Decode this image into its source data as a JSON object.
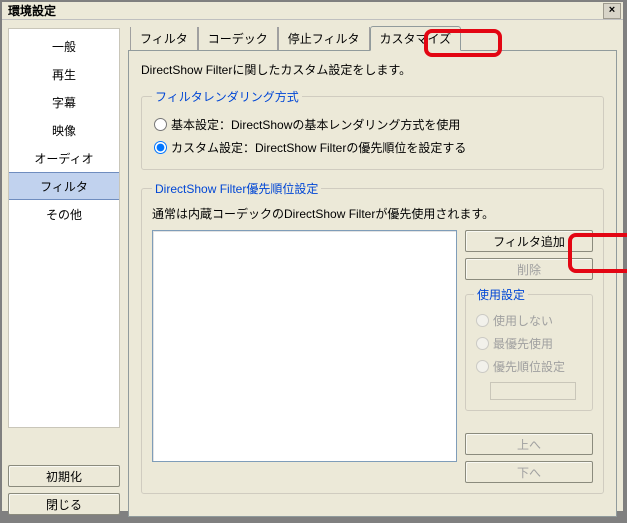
{
  "window": {
    "title": "環境設定",
    "close": "×"
  },
  "sidebar": {
    "items": [
      {
        "label": "一般"
      },
      {
        "label": "再生"
      },
      {
        "label": "字幕"
      },
      {
        "label": "映像"
      },
      {
        "label": "オーディオ"
      },
      {
        "label": "フィルタ"
      },
      {
        "label": "その他"
      }
    ],
    "selected_index": 5,
    "init_label": "初期化",
    "close_label": "閉じる"
  },
  "tabs": {
    "items": [
      {
        "label": "フィルタ"
      },
      {
        "label": "コーデック"
      },
      {
        "label": "停止フィルタ"
      },
      {
        "label": "カスタマイズ"
      }
    ],
    "active_index": 3
  },
  "page": {
    "description": "DirectShow Filterに関したカスタム設定をします。",
    "render_group": "フィルタレンダリング方式",
    "render_basic": "基本設定：DirectShowの基本レンダリング方式を使用",
    "render_custom": "カスタム設定：DirectShow Filterの優先順位を設定する",
    "priority_group": "DirectShow Filter優先順位設定",
    "priority_desc": "通常は内蔵コーデックのDirectShow Filterが優先使用されます。",
    "add_filter": "フィルタ追加",
    "delete": "削除",
    "usage_group": "使用設定",
    "usage_none": "使用しない",
    "usage_top": "最優先使用",
    "usage_order": "優先順位設定",
    "move_up": "上へ",
    "move_down": "下へ"
  }
}
